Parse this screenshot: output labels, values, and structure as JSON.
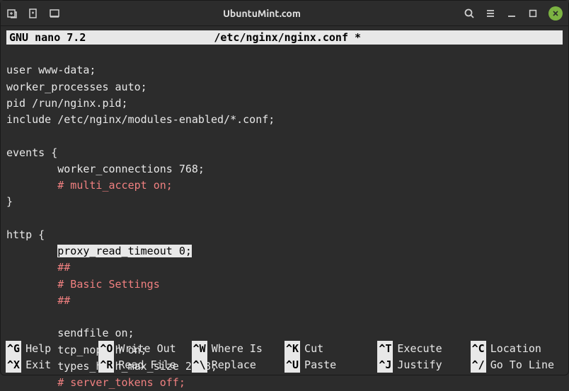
{
  "titlebar": {
    "title": "UbuntuMint.com"
  },
  "nano": {
    "app": "GNU nano 7.2",
    "filename": "/etc/nginx/nginx.conf *"
  },
  "code": {
    "l1": "user www-data;",
    "l2": "worker_processes auto;",
    "l3": "pid /run/nginx.pid;",
    "l4": "include /etc/nginx/modules-enabled/*.conf;",
    "l5": "",
    "l6": "events {",
    "l7": "worker_connections 768;",
    "l8": "# multi_accept on;",
    "l9": "}",
    "l10": "",
    "l11": "http {",
    "l12_hl": "proxy_read_timeout 0;",
    "l13": "##",
    "l14": "# Basic Settings",
    "l15": "##",
    "l16": "",
    "l17": "sendfile on;",
    "l18": "tcp_nopush on;",
    "l19": "types_hash_max_size 2048;",
    "l20": "# server_tokens off;"
  },
  "shortcuts": {
    "help": {
      "key": "^G",
      "label": "Help"
    },
    "writeout": {
      "key": "^O",
      "label": "Write Out"
    },
    "whereis": {
      "key": "^W",
      "label": "Where Is"
    },
    "cut": {
      "key": "^K",
      "label": "Cut"
    },
    "execute": {
      "key": "^T",
      "label": "Execute"
    },
    "location": {
      "key": "^C",
      "label": "Location"
    },
    "exit": {
      "key": "^X",
      "label": "Exit"
    },
    "readfile": {
      "key": "^R",
      "label": "Read File"
    },
    "replace": {
      "key": "^\\",
      "label": "Replace"
    },
    "paste": {
      "key": "^U",
      "label": "Paste"
    },
    "justify": {
      "key": "^J",
      "label": "Justify"
    },
    "gotoline": {
      "key": "^/",
      "label": "Go To Line"
    }
  }
}
